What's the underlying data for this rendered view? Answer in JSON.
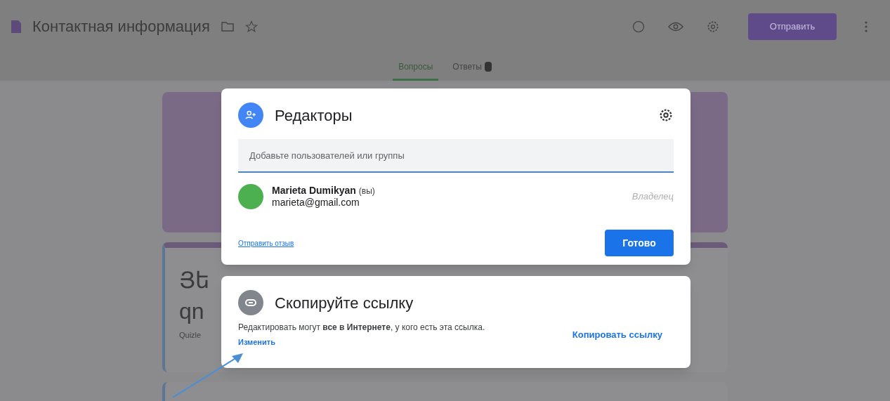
{
  "header": {
    "title": "Контактная информация",
    "send_button": "Отправить"
  },
  "tabs": [
    {
      "label": "Вопросы",
      "selected": true
    },
    {
      "label": "Ответы",
      "selected": false
    }
  ],
  "form_card": {
    "title_fragments": [
      "Յե",
      "qn"
    ],
    "subtitle_fragment": "Quizle"
  },
  "editors_dialog": {
    "title": "Редакторы",
    "add_placeholder": "Добавьте пользователей или группы",
    "users": [
      {
        "name": "Marieta Dumikyan",
        "suffix": "(вы)",
        "email": "marieta@gmail.com",
        "role": "Владелец",
        "color": "#4caf50"
      }
    ],
    "feedback_link": "Отправить отзыв",
    "done_button": "Готово"
  },
  "link_dialog": {
    "title": "Скопируйте ссылку",
    "description": "Редактировать могут **все в Интернете**, у кого есть эта ссылка.",
    "change_link": "Изменить",
    "copy_button": "Копировать ссылку"
  }
}
